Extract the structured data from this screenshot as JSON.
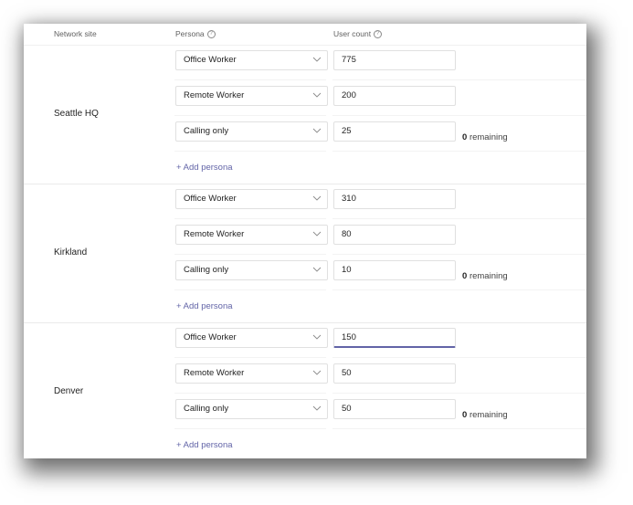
{
  "header": {
    "network_site": "Network site",
    "persona": "Persona",
    "user_count": "User count",
    "help_icon": "question-circle-icon"
  },
  "groups": [
    {
      "site": "Seattle HQ",
      "rows": [
        {
          "persona": "Office Worker",
          "count": "775"
        },
        {
          "persona": "Remote Worker",
          "count": "200"
        },
        {
          "persona": "Calling only",
          "count": "25"
        }
      ],
      "remaining_value": "0",
      "remaining_label": "remaining",
      "add_persona": "+ Add persona"
    },
    {
      "site": "Kirkland",
      "rows": [
        {
          "persona": "Office Worker",
          "count": "310"
        },
        {
          "persona": "Remote Worker",
          "count": "80"
        },
        {
          "persona": "Calling only",
          "count": "10"
        }
      ],
      "remaining_value": "0",
      "remaining_label": "remaining",
      "add_persona": "+ Add persona"
    },
    {
      "site": "Denver",
      "rows": [
        {
          "persona": "Office Worker",
          "count": "150",
          "focused": true
        },
        {
          "persona": "Remote Worker",
          "count": "50"
        },
        {
          "persona": "Calling only",
          "count": "50"
        }
      ],
      "remaining_value": "0",
      "remaining_label": "remaining",
      "add_persona": "+ Add persona"
    }
  ],
  "colors": {
    "accent": "#6264a7",
    "border": "#e0e0e0"
  }
}
